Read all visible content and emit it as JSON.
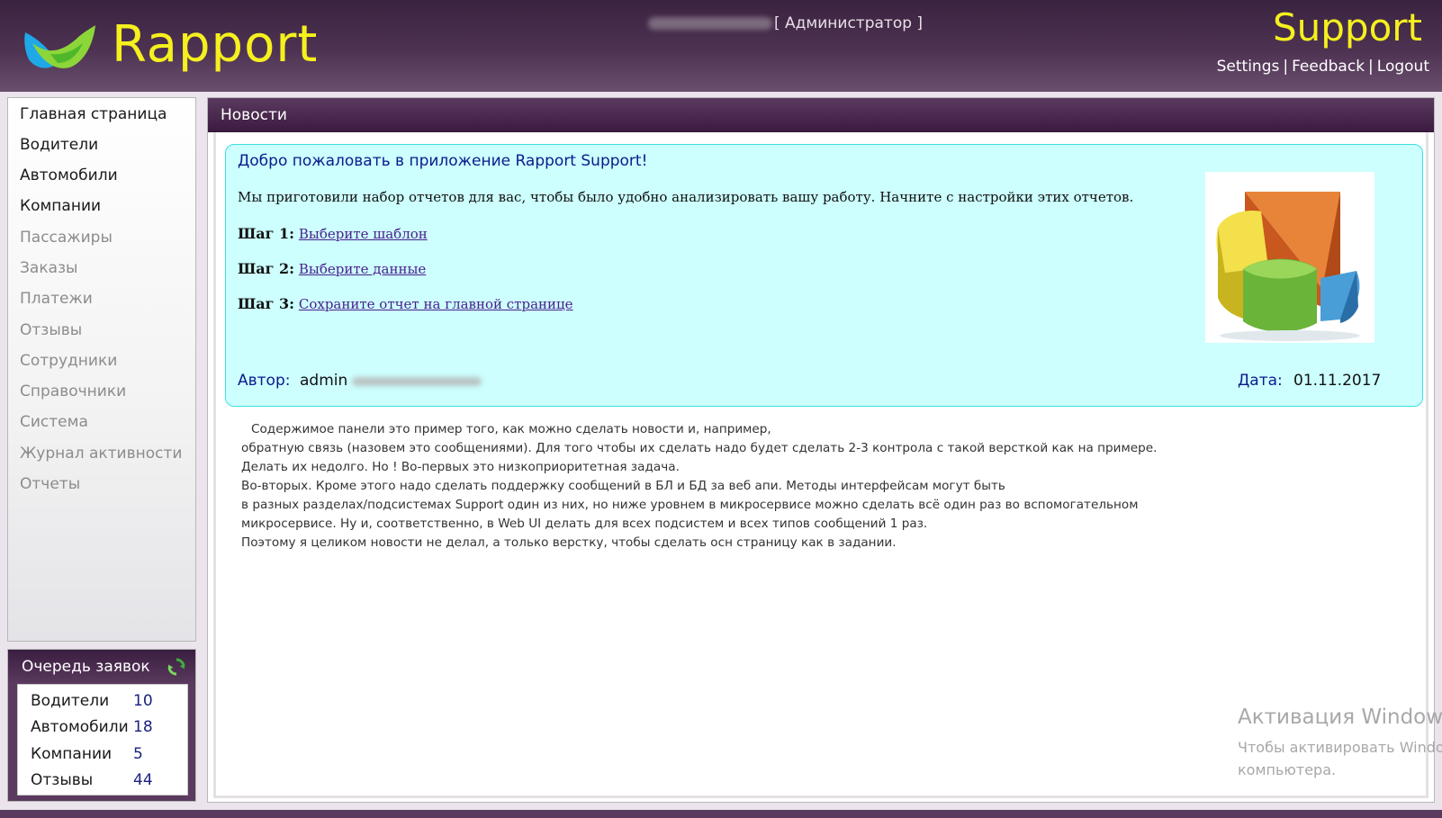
{
  "header": {
    "logo_text": "Rapport",
    "role": "[ Администратор ]",
    "brand": "Support",
    "links": [
      "Settings",
      "Feedback",
      "Logout"
    ],
    "link_separator": "|"
  },
  "nav": {
    "items": [
      {
        "label": "Главная страница",
        "state": "active"
      },
      {
        "label": "Водители",
        "state": "active"
      },
      {
        "label": "Автомобили",
        "state": "active"
      },
      {
        "label": "Компании",
        "state": "active"
      },
      {
        "label": "Пассажиры",
        "state": "muted"
      },
      {
        "label": "Заказы",
        "state": "muted"
      },
      {
        "label": "Платежи",
        "state": "muted"
      },
      {
        "label": "Отзывы",
        "state": "muted"
      },
      {
        "label": "Сотрудники",
        "state": "muted"
      },
      {
        "label": "Справочники",
        "state": "muted"
      },
      {
        "label": "Система",
        "state": "muted"
      },
      {
        "label": "Журнал активности",
        "state": "muted"
      },
      {
        "label": "Отчеты",
        "state": "muted"
      }
    ]
  },
  "queue": {
    "title": "Очередь заявок",
    "refresh_icon": "refresh-icon",
    "rows": [
      {
        "label": "Водители",
        "count": "10"
      },
      {
        "label": "Автомобили",
        "count": "18"
      },
      {
        "label": "Компании",
        "count": "5"
      },
      {
        "label": "Отзывы",
        "count": "44"
      }
    ]
  },
  "main": {
    "title": "Новости",
    "news": {
      "title": "Добро пожаловать в приложение Rapport Support!",
      "intro": "Мы приготовили набор отчетов для вас, чтобы было удобно анализировать вашу работу. Начните с настройки этих отчетов.",
      "steps": [
        {
          "label": "Шаг 1:",
          "link": "Выберите шаблон"
        },
        {
          "label": "Шаг 2:",
          "link": "Выберите данные"
        },
        {
          "label": "Шаг 3:",
          "link": "Сохраните отчет на главной странице"
        }
      ],
      "author_label": "Автор:",
      "author_name": "admin",
      "date_label": "Дата:",
      "date_value": "01.11.2017",
      "image_icon": "pie-chart-icon"
    },
    "description": [
      "Содержимое панели это пример того, как можно сделать новости и, например,",
      "обратную связь (назовем это сообщениями). Для того чтобы их сделать надо будет сделать 2-3 контрола с такой версткой как на примере.",
      "Делать их недолго. Но ! Во-первых это низкоприоритетная задача.",
      "Во-вторых. Кроме этого надо сделать поддержку сообщений в БЛ и БД за веб апи. Методы интерфейсам могут быть",
      "в разных разделах/подсистемах Support один из них, но ниже уровнем в микросервисе можно сделать всё один раз во вспомогательном",
      "микросервисе. Ну и, соответственно, в Web UI делать для всех подсистем и всех типов сообщений 1 раз.",
      "Поэтому я целиком новости не делал, а только верстку, чтобы сделать осн страницу как в задании."
    ]
  },
  "watermark": {
    "title": "Активация Windows",
    "line1": "Чтобы активировать Windows",
    "line2": "компьютера."
  },
  "colors": {
    "header_bg": "#4e3252",
    "brand_yellow": "#f5f01e",
    "news_bg": "#ccfffe",
    "news_border": "#3fe0e0",
    "link": "#4a1f8c",
    "label_blue": "#0b1a8c"
  }
}
